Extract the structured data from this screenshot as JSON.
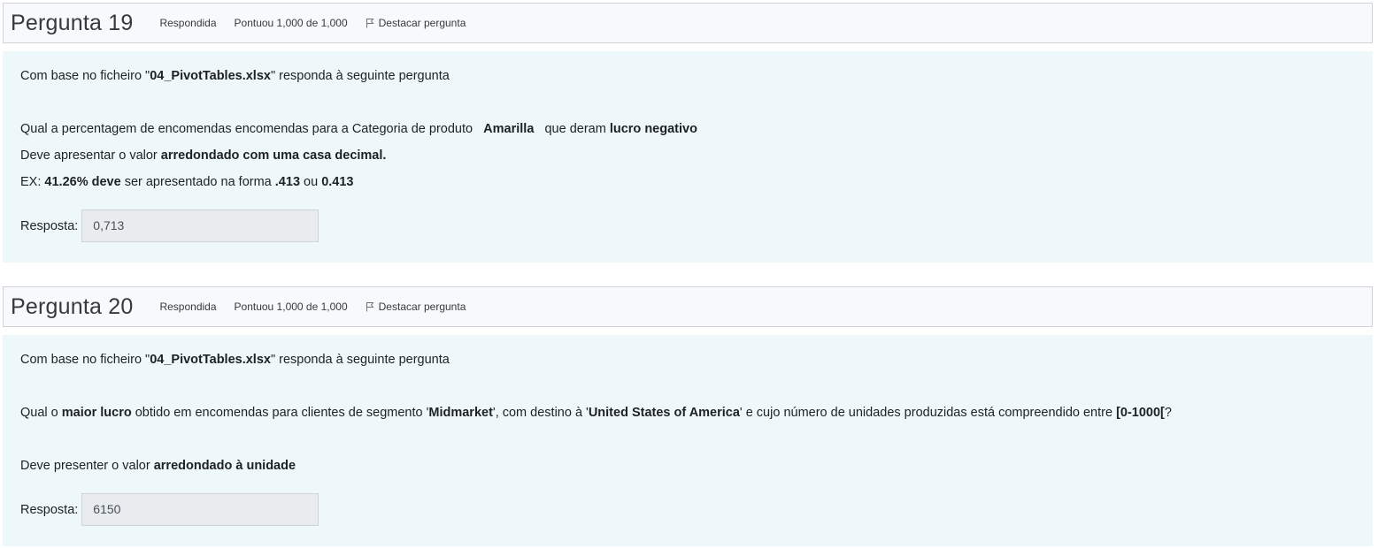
{
  "questions": [
    {
      "title_word": "Pergunta",
      "number": "19",
      "status": "Respondida",
      "grade": "Pontuou 1,000 de 1,000",
      "flag_label": "Destacar pergunta",
      "intro": {
        "before": "Com base no ficheiro \"",
        "file": "04_PivotTables.xlsx",
        "after": "\" responda à seguinte pergunta"
      },
      "q_line": {
        "t1": "Qual a percentagem de encomendas encomendas para a Categoria de produto ",
        "b1": "Amarilla",
        "t2": " que deram ",
        "b2": "lucro negativo"
      },
      "round_line": {
        "t1": "Deve apresentar o valor ",
        "b1": "arredondado com uma casa decimal."
      },
      "ex_line": {
        "t1": "EX: ",
        "b1": "41.26% deve",
        "t2": " ser apresentado na forma ",
        "b2": ".413",
        "t3": " ou ",
        "b3": "0.413"
      },
      "answer_label": "Resposta:",
      "answer_value": "0,713"
    },
    {
      "title_word": "Pergunta",
      "number": "20",
      "status": "Respondida",
      "grade": "Pontuou 1,000 de 1,000",
      "flag_label": "Destacar pergunta",
      "intro": {
        "before": "Com base no ficheiro \"",
        "file": "04_PivotTables.xlsx",
        "after": "\" responda à seguinte pergunta"
      },
      "q_line": {
        "t1": "Qual o ",
        "b1": "maior lucro",
        "t2": " obtido em encomendas para clientes de segmento '",
        "b2": "Midmarket",
        "t3": "', com destino à '",
        "b3": "United States of America",
        "t4": "' e cujo número de unidades produzidas está compreendido entre ",
        "b4": "[0-1000[",
        "t5": "?"
      },
      "round_line": {
        "t1": "Deve presenter o valor ",
        "b1": "arredondado à unidade"
      },
      "answer_label": "Resposta:",
      "answer_value": "6150"
    }
  ]
}
